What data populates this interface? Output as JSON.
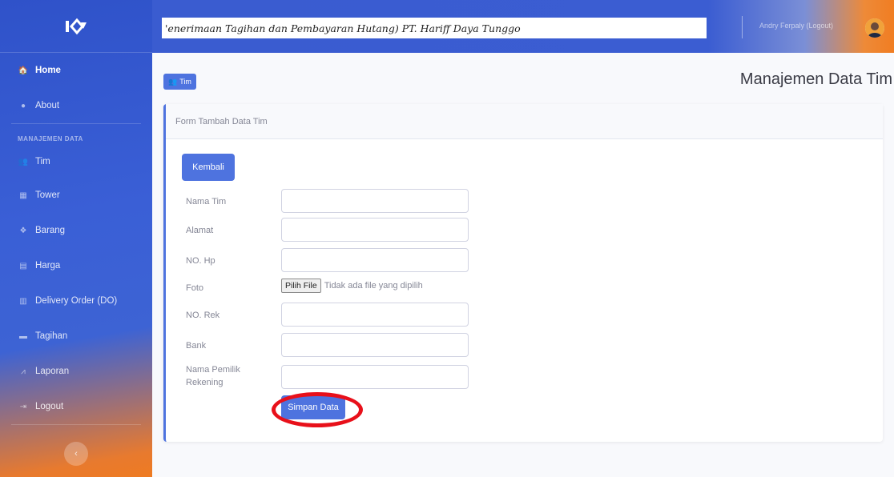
{
  "sidebar": {
    "items": [
      {
        "label": "Home",
        "icon": "home-icon",
        "glyph": "🏠"
      },
      {
        "label": "About",
        "icon": "info-icon",
        "glyph": "●"
      }
    ],
    "heading": "MANAJEMEN DATA",
    "data_items": [
      {
        "label": "Tim",
        "icon": "users-icon",
        "glyph": "👥"
      },
      {
        "label": "Tower",
        "icon": "table-icon",
        "glyph": "▦"
      },
      {
        "label": "Barang",
        "icon": "boxes-icon",
        "glyph": "❖"
      },
      {
        "label": "Harga",
        "icon": "receipt-icon",
        "glyph": "▤"
      },
      {
        "label": "Delivery Order (DO)",
        "icon": "calendar-icon",
        "glyph": "▥"
      },
      {
        "label": "Tagihan",
        "icon": "folder-icon",
        "glyph": "▬"
      },
      {
        "label": "Laporan",
        "icon": "chart-icon",
        "glyph": "⩘"
      },
      {
        "label": "Logout",
        "icon": "logout-icon",
        "glyph": "⇥"
      }
    ],
    "toggle_glyph": "‹"
  },
  "topbar": {
    "banner_text": "'enerimaan Tagihan dan Pembayaran Hutang) PT. Hariff Daya Tunggo",
    "user_name": "Andry Ferpaly (Logout)"
  },
  "content": {
    "badge_label": "Tim",
    "page_heading": "Manajemen Data Tim",
    "card_header": "Form Tambah Data Tim",
    "back_button": "Kembali",
    "fields": {
      "nama_tim": "Nama Tim",
      "alamat": "Alamat",
      "no_hp": "NO. Hp",
      "foto": "Foto",
      "no_rek": "NO. Rek",
      "bank": "Bank",
      "nama_pemilik_1": "Nama Pemilik",
      "nama_pemilik_2": "Rekening"
    },
    "file_button": "Pilih File",
    "file_status": "Tidak ada file yang dipilih",
    "save_button": "Simpan Data"
  },
  "colors": {
    "primary": "#4e73df",
    "highlight": "#e8101a",
    "accent_orange": "#f07d22"
  }
}
